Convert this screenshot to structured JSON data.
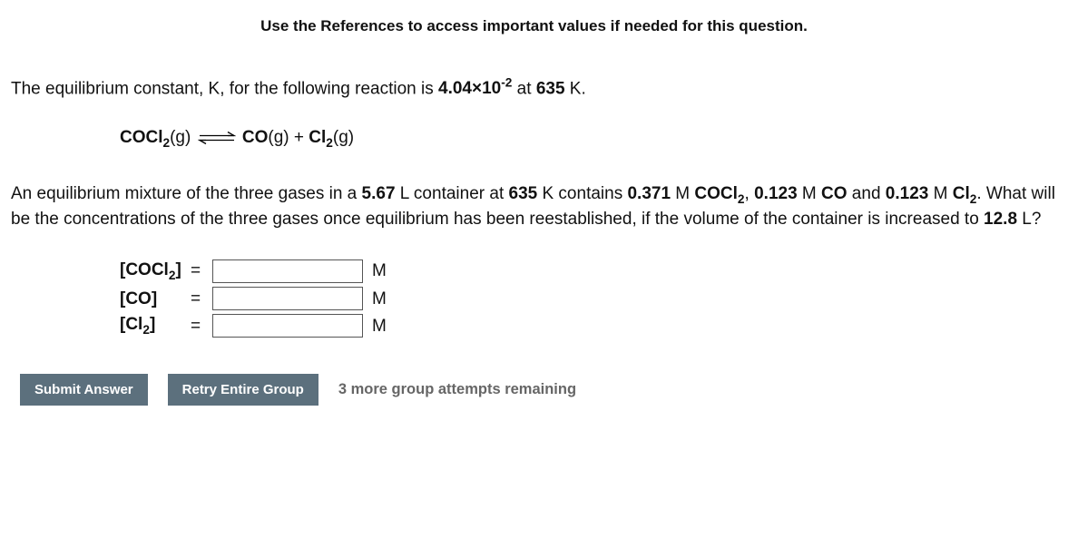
{
  "instructions": "Use the References to access important values if needed for this question.",
  "intro_1": "The equilibrium constant, K, for the following reaction is ",
  "K_value": "4.04×10",
  "K_exp": "-2",
  "intro_2": " at ",
  "temperature": "635",
  "intro_3": " K.",
  "equation": {
    "p1": "COCl",
    "sub1": "2",
    "p2": "(g)",
    "p3": "CO",
    "p4": "(g) + ",
    "p5": "Cl",
    "sub2": "2",
    "p6": "(g)"
  },
  "para2_a": "An equilibrium mixture of the three gases in a ",
  "vol1": "5.67",
  "para2_b": " L container at ",
  "temp2": "635",
  "para2_c": " K contains ",
  "conc_cocl2": "0.371",
  "para2_d": " M ",
  "sp_cocl2_a": "COCl",
  "sp_cocl2_b": "2",
  "comma": ",   ",
  "conc_co": "0.123",
  "para2_e": " M ",
  "sp_co": "CO",
  "para2_f": " and ",
  "conc_cl2": "0.123",
  "para2_g": " M ",
  "sp_cl2_a": "Cl",
  "sp_cl2_b": "2",
  "para2_h": ". What will be the concentrations of the three gases once equilibrium has been reestablished, if the volume of the container is increased to ",
  "vol2": "12.8",
  "para2_i": " L?",
  "row1": {
    "l_a": "[COCl",
    "l_b": "2",
    "l_c": "]",
    "eq": "=",
    "unit": "M"
  },
  "row2": {
    "l_a": "[CO]",
    "eq": "=",
    "unit": "M"
  },
  "row3": {
    "l_a": "[Cl",
    "l_b": "2",
    "l_c": "]",
    "eq": "=",
    "unit": "M"
  },
  "buttons": {
    "submit": "Submit Answer",
    "retry": "Retry Entire Group"
  },
  "attempts_a": "3",
  "attempts_b": " more group attempts remaining"
}
